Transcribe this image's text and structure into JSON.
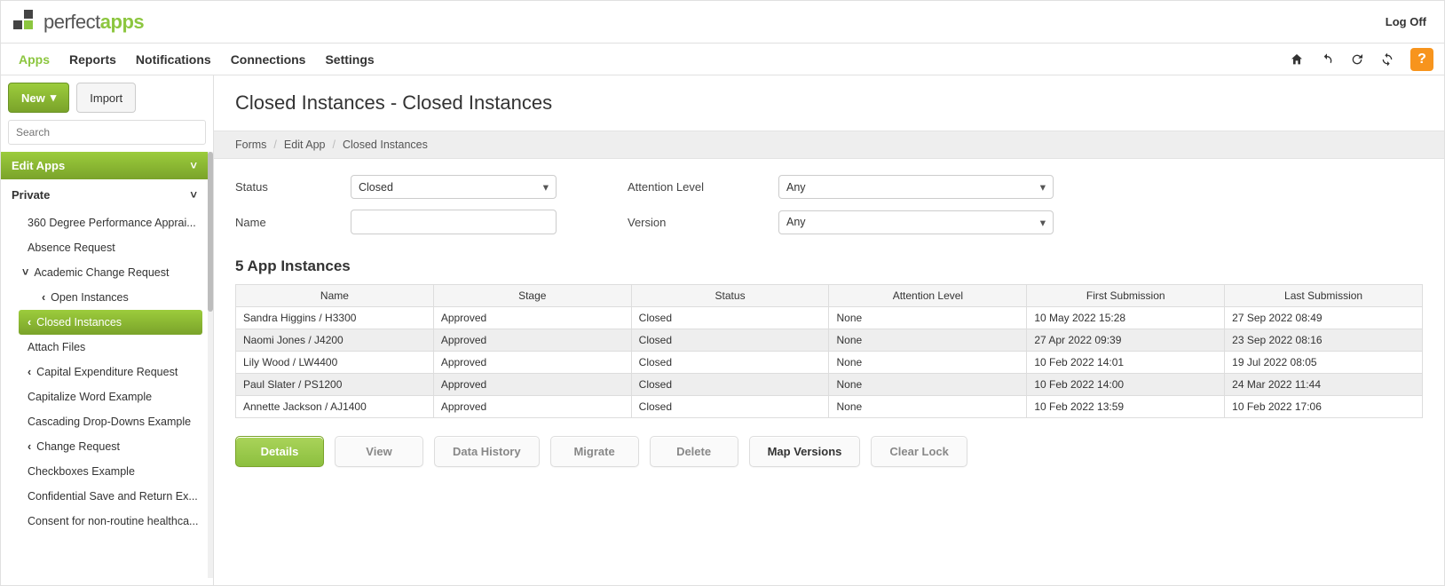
{
  "header": {
    "brand_first": "perfect",
    "brand_second": "apps",
    "logoff": "Log Off"
  },
  "nav": {
    "items": [
      "Apps",
      "Reports",
      "Notifications",
      "Connections",
      "Settings"
    ],
    "active_index": 0
  },
  "sidebar": {
    "new_label": "New",
    "import_label": "Import",
    "search_placeholder": "Search",
    "section_title": "Edit Apps",
    "group_title": "Private",
    "tree": [
      {
        "label": "360 Degree Performance Apprai...",
        "level": 1
      },
      {
        "label": "Absence Request",
        "level": 1
      },
      {
        "label": "Academic Change Request",
        "level": 1,
        "expanded": true
      },
      {
        "label": "Open Instances",
        "level": 2,
        "chev": "left"
      },
      {
        "label": "Closed Instances",
        "level": 2,
        "chev": "left",
        "selected": true
      },
      {
        "label": "Attach Files",
        "level": 1
      },
      {
        "label": "Capital Expenditure Request",
        "level": 1,
        "chev": "left"
      },
      {
        "label": "Capitalize Word Example",
        "level": 1
      },
      {
        "label": "Cascading Drop-Downs Example",
        "level": 1
      },
      {
        "label": "Change Request",
        "level": 1,
        "chev": "left"
      },
      {
        "label": "Checkboxes Example",
        "level": 1
      },
      {
        "label": "Confidential Save and Return Ex...",
        "level": 1
      },
      {
        "label": "Consent for non-routine healthca...",
        "level": 1
      }
    ]
  },
  "page": {
    "title": "Closed Instances - Closed Instances",
    "breadcrumb": [
      "Forms",
      "Edit App",
      "Closed Instances"
    ]
  },
  "filters": {
    "status_label": "Status",
    "status_value": "Closed",
    "attention_label": "Attention Level",
    "attention_value": "Any",
    "name_label": "Name",
    "name_value": "",
    "version_label": "Version",
    "version_value": "Any"
  },
  "table": {
    "title": "5 App Instances",
    "headers": [
      "Name",
      "Stage",
      "Status",
      "Attention Level",
      "First Submission",
      "Last Submission"
    ],
    "rows": [
      {
        "cells": [
          "Sandra Higgins / H3300",
          "Approved",
          "Closed",
          "None",
          "10 May 2022 15:28",
          "27 Sep 2022 08:49"
        ]
      },
      {
        "cells": [
          "Naomi Jones / J4200",
          "Approved",
          "Closed",
          "None",
          "27 Apr 2022 09:39",
          "23 Sep 2022 08:16"
        ]
      },
      {
        "cells": [
          "Lily Wood / LW4400",
          "Approved",
          "Closed",
          "None",
          "10 Feb 2022 14:01",
          "19 Jul 2022 08:05"
        ]
      },
      {
        "cells": [
          "Paul Slater / PS1200",
          "Approved",
          "Closed",
          "None",
          "10 Feb 2022 14:00",
          "24 Mar 2022 11:44"
        ]
      },
      {
        "cells": [
          "Annette Jackson / AJ1400",
          "Approved",
          "Closed",
          "None",
          "10 Feb 2022 13:59",
          "10 Feb 2022 17:06"
        ]
      }
    ]
  },
  "actions": {
    "details": "Details",
    "view": "View",
    "data_history": "Data History",
    "migrate": "Migrate",
    "delete": "Delete",
    "map_versions": "Map Versions",
    "clear_lock": "Clear Lock"
  }
}
